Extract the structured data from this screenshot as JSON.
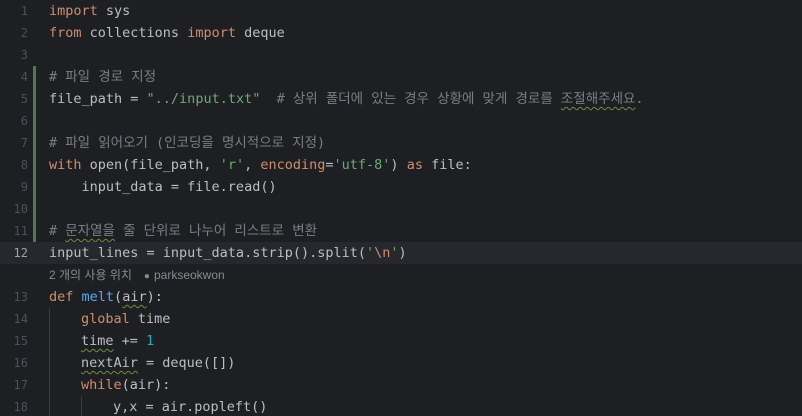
{
  "editor": {
    "lines": {
      "l1": {
        "no": "1",
        "t1": "import",
        "t2": " sys"
      },
      "l2": {
        "no": "2",
        "t1": "from",
        "t2": " collections ",
        "t3": "import",
        "t4": " deque"
      },
      "l3": {
        "no": "3"
      },
      "l4": {
        "no": "4",
        "c1": "# 파일 경로 지정"
      },
      "l5": {
        "no": "5",
        "t1": "file_path = ",
        "s1": "\"../input.txt\"",
        "c1": "  # 상위 폴더에 있는 경우 상황에 맞게 경로를 ",
        "c2": "조절해주세요",
        "c3": "."
      },
      "l6": {
        "no": "6"
      },
      "l7": {
        "no": "7",
        "c1": "# 파일 읽어오기 (인코딩을 명시적으로 지정)"
      },
      "l8": {
        "no": "8",
        "k1": "with",
        "t1": " open(file_path, ",
        "s1": "'r'",
        "t2": ", ",
        "p1": "encoding",
        "t3": "=",
        "s2": "'utf-8'",
        "t4": ") ",
        "k2": "as",
        "t5": " file:"
      },
      "l9": {
        "no": "9",
        "t1": "    input_data = file.read()"
      },
      "l10": {
        "no": "10"
      },
      "l11": {
        "no": "11",
        "c1": "# ",
        "c2": "문자열을",
        "c3": " 줄 단위로 나누어 리스트로 변환"
      },
      "l12": {
        "no": "12",
        "t1": "input_lines = input_data.strip().split(",
        "s1": "'",
        "e1": "\\n",
        "s2": "'",
        "t2": ")"
      },
      "l13": {
        "no": "13",
        "k1": "def",
        "t1": " ",
        "f1": "melt",
        "t2": "(",
        "u1": "air",
        "t3": "):"
      },
      "l14": {
        "no": "14",
        "k1": "global",
        "t1": " time"
      },
      "l15": {
        "no": "15",
        "u1": "time",
        "t1": " += ",
        "n1": "1"
      },
      "l16": {
        "no": "16",
        "u1": "nextAir",
        "t1": " = deque([])"
      },
      "l17": {
        "no": "17",
        "k1": "while",
        "t1": "(air):"
      },
      "l18": {
        "no": "18",
        "t1": "y,x = air.popleft()"
      }
    },
    "usage_hint": {
      "count": "2 개의 사용 위치",
      "icon": "person-icon",
      "author": "parkseokwon"
    },
    "colors": {
      "background": "#1e1f22",
      "keyword": "#cf8e6d",
      "string": "#6aab73",
      "comment": "#7a7e85",
      "function": "#56a8f5",
      "number": "#2aacb8",
      "change_marker": "#4e7a4f"
    }
  }
}
